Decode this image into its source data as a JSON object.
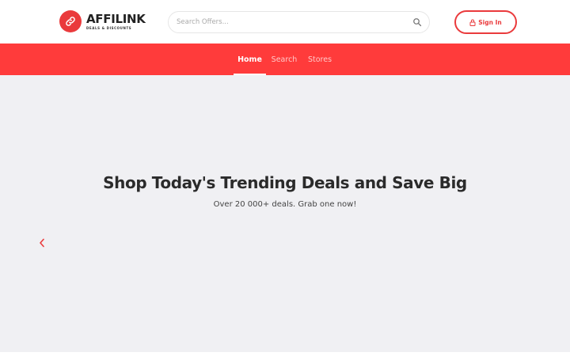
{
  "header": {
    "logo": {
      "name": "AFFILINK",
      "tagline": "DEALS & DISCOUNTS",
      "icon": "link-icon"
    },
    "search": {
      "placeholder": "Search Offers...",
      "value": "",
      "icon": "search-icon"
    },
    "signin": {
      "label": "Sign In",
      "icon": "lock-icon"
    }
  },
  "nav": {
    "items": [
      {
        "label": "Home",
        "active": true
      },
      {
        "label": "Search",
        "active": false
      },
      {
        "label": "Stores",
        "active": false
      }
    ]
  },
  "hero": {
    "title": "Shop Today's Trending Deals and Save Big",
    "subtitle": "Over 20 000+ deals. Grab one now!",
    "prev_icon": "chevron-left-icon"
  },
  "colors": {
    "brand_red": "#ea3a3c",
    "nav_red": "#ff3b3b",
    "hero_bg": "#f0f0f3",
    "text_dark": "#2b2b2b"
  }
}
